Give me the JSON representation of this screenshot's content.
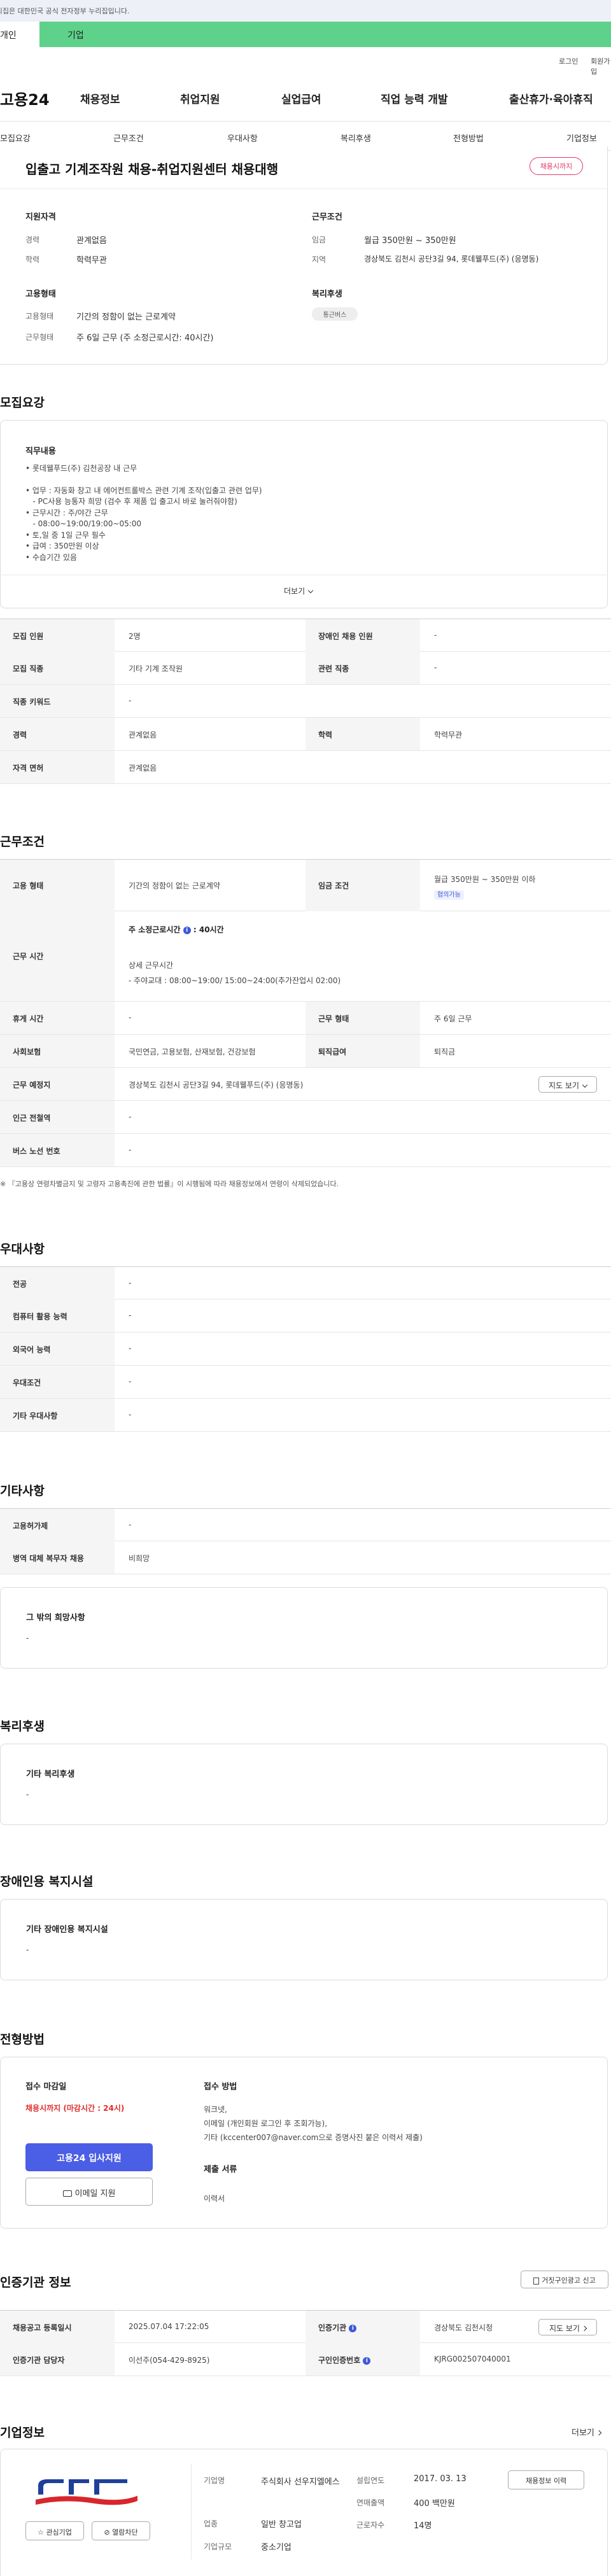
{
  "gov_banner": "이 누리집은 대한민국 공식 전자정부 누리집입니다.",
  "user_tabs": {
    "personal": "개인",
    "company": "기업"
  },
  "util": {
    "login": "로그인",
    "join": "회원가입"
  },
  "logo": "고용24",
  "gnb": [
    "채용정보",
    "취업지원",
    "실업급여",
    "직업 능력 개발",
    "출산휴가·육아휴직"
  ],
  "subnav": [
    "모집요강",
    "근무조건",
    "우대사항",
    "복리후생",
    "전형방법",
    "기업정보"
  ],
  "summary": {
    "title": "입출고 기계조작원 채용-취업지원센터 채용대행",
    "status": "채용시까지",
    "qual_title": "지원자격",
    "career_label": "경력",
    "career_value": "관계없음",
    "edu_label": "학력",
    "edu_value": "학력무관",
    "work_title": "근무조건",
    "wage_label": "임금",
    "wage_value": "월급 350만원 ~ 350만원",
    "region_label": "지역",
    "region_value": "경상북도 김천시 공단3길 94, 롯데웰푸드(주) (응명동)",
    "emp_title": "고용형태",
    "emp_label": "고용형태",
    "emp_value": "기간의 정함이 없는 근로계약",
    "worktype_label": "근무형태",
    "worktype_value": "주 6일 근무 (주 소정근로시간: 40시간)",
    "welfare_title": "복리후생",
    "welfare_tag": "통근버스"
  },
  "recruit": {
    "heading": "모집요강",
    "duty_title": "직무내용",
    "duty_lines": [
      "• 롯데웰푸드(주) 김천공장 내 근무",
      "",
      "• 업무 : 자동화 창고 내 에어컨트롤박스 관련 기계 조작(입출고 관련 업무)",
      "   - PC사용 능통자 희망 (검수 후 제품 입 출고시 바로 눌러줘야함)",
      "• 근무시간 : 주/야간 근무",
      "   - 08:00~19:00/19:00~05:00",
      "• 토,일 중 1일 근무 필수",
      "• 급여 : 350만원 이상",
      "• 수습기간 있음"
    ],
    "more": "더보기",
    "table": [
      {
        "l1": "모집 인원",
        "v1": "2명",
        "l2": "장애인 채용 인원",
        "v2": "-"
      },
      {
        "l1": "모집 직종",
        "v1": "기타 기계 조작원",
        "l2": "관련 직종",
        "v2": "-"
      },
      {
        "l1": "직종 키워드",
        "v1": "-"
      },
      {
        "l1": "경력",
        "v1": "관계없음",
        "l2": "학력",
        "v2": "학력무관"
      },
      {
        "l1": "자격 면허",
        "v1": "관계없음"
      }
    ]
  },
  "work": {
    "heading": "근무조건",
    "emp_l": "고용 형태",
    "emp_v": "기간의 정함이 없는 근로계약",
    "wage_l": "임금 조건",
    "wage_v": "월급 350만원 ~ 350만원 이하",
    "wage_tag": "협의가능",
    "hours_l": "근무 시간",
    "hours_main": "주 소정근로시간",
    "hours_sep": ":",
    "hours_val": "40시간",
    "hours_detail_t": "상세 근무시간",
    "hours_detail": "- 주야교대 : 08:00~19:00/ 15:00~24:00(추가잔업시 02:00)",
    "rest_l": "휴게 시간",
    "rest_v": "-",
    "form_l": "근무 형태",
    "form_v": "주 6일 근무",
    "ins_l": "사회보험",
    "ins_v": "국민연금, 고용보험, 산재보험, 건강보험",
    "sev_l": "퇴직급여",
    "sev_v": "퇴직금",
    "place_l": "근무 예정지",
    "place_v": "경상북도 김천시 공단3길 94, 롯데웰푸드(주) (응명동)",
    "map_btn": "지도 보기",
    "station_l": "인근 전철역",
    "station_v": "-",
    "bus_l": "버스 노선 번호",
    "bus_v": "-",
    "note": "※ 『고용상 연령차별금지 및 고령자 고용촉진에 관한 법률』이 시행됨에 따라 채용정보에서 연령이 삭제되었습니다."
  },
  "pref": {
    "heading": "우대사항",
    "rows": [
      {
        "l": "전공",
        "v": "-"
      },
      {
        "l": "컴퓨터 활용 능력",
        "v": "-"
      },
      {
        "l": "외국어 능력",
        "v": "-"
      },
      {
        "l": "우대조건",
        "v": "-"
      },
      {
        "l": "기타 우대사항",
        "v": "-"
      }
    ]
  },
  "etc": {
    "heading": "기타사항",
    "rows": [
      {
        "l": "고용허가제",
        "v": "-"
      },
      {
        "l": "병역 대체 복무자 채용",
        "v": "비희망"
      }
    ],
    "other_t": "그 밖의 희망사항",
    "other_v": "-"
  },
  "welfare": {
    "heading": "복리후생",
    "box_t": "기타 복리후생",
    "box_v": "-"
  },
  "disab": {
    "heading": "장애인용 복지시설",
    "box_t": "기타 장애인용 복지시설",
    "box_v": "-"
  },
  "selection": {
    "heading": "전형방법",
    "deadline_t": "접수 마감일",
    "deadline_v": "채용시까지 (마감시간 : 24시)",
    "apply_btn": "고용24 입사지원",
    "email_btn": "이메일 지원",
    "method_t": "접수 방법",
    "methods": [
      "워크넷,",
      "이메일 (개인회원 로그인 후 조회가능),",
      "기타 (kccenter007@naver.com으로 증명사진 붙은 이력서 제출)"
    ],
    "docs_t": "제출 서류",
    "docs_v": "이력서"
  },
  "agency": {
    "heading": "인증기관 정보",
    "report_btn": "거짓구인광고 신고",
    "reg_l": "채용공고 등록일시",
    "reg_v": "2025.07.04 17:22:05",
    "org_l": "인증기관",
    "org_v": "경상북도 김천시청",
    "map_btn": "지도 보기",
    "mgr_l": "인증기관 담당자",
    "mgr_v": "이선주(054-429-8925)",
    "no_l": "구인인증번호",
    "no_v": "KJRG002507040001"
  },
  "company": {
    "heading": "기업정보",
    "more": "더보기",
    "name_l": "기업명",
    "name_v": "주식회사 선우지엘에스",
    "ind_l": "업종",
    "ind_v": "일반 창고업",
    "size_l": "기업규모",
    "size_v": "중소기업",
    "est_l": "설립연도",
    "est_v": "2017. 03. 13",
    "sales_l": "연매출액",
    "sales_v": "400 백만원",
    "emp_l": "근로자수",
    "emp_v": "14명",
    "info_btn": "채용정보 이력",
    "fav_btn": "관심기업",
    "block_btn": "열람차단"
  }
}
